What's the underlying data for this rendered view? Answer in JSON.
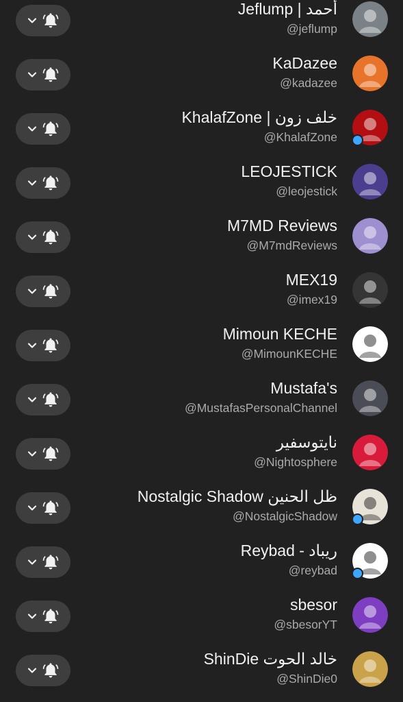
{
  "subscriptions": [
    {
      "name": "Jeflump | أحمد",
      "handle": "@jeflump",
      "avatar_color": "#7a8288",
      "live_dot": false,
      "avatar_icon": "jeflump-avatar"
    },
    {
      "name": "KaDazee",
      "handle": "@kadazee",
      "avatar_color": "#e7742a",
      "live_dot": false,
      "avatar_icon": "kadazee-avatar"
    },
    {
      "name": "KhalafZone | خلف زون",
      "handle": "@KhalafZone",
      "avatar_color": "#b30f12",
      "live_dot": true,
      "avatar_icon": "khalafzone-avatar"
    },
    {
      "name": "LEOJESTICK",
      "handle": "@leojestick",
      "avatar_color": "#4c3e8f",
      "live_dot": false,
      "avatar_icon": "leojestick-avatar"
    },
    {
      "name": "M7MD Reviews",
      "handle": "@M7mdReviews",
      "avatar_color": "#9e8fd1",
      "live_dot": false,
      "avatar_icon": "m7md-avatar"
    },
    {
      "name": "MEX19",
      "handle": "@imex19",
      "avatar_color": "#353535",
      "live_dot": false,
      "avatar_icon": "mex19-avatar"
    },
    {
      "name": "Mimoun KECHE",
      "handle": "@MimounKECHE",
      "avatar_color": "#ffffff",
      "live_dot": false,
      "avatar_icon": "mimoun-avatar"
    },
    {
      "name": "Mustafa's",
      "handle": "@MustafasPersonalChannel",
      "avatar_color": "#4a4d55",
      "live_dot": false,
      "avatar_icon": "mustafa-avatar"
    },
    {
      "name": "نايتوسفير",
      "handle": "@Nightosphere",
      "avatar_color": "#d81b3a",
      "live_dot": false,
      "avatar_icon": "nightosphere-avatar"
    },
    {
      "name": "Nostalgic Shadow ظل الحنين",
      "handle": "@NostalgicShadow",
      "avatar_color": "#e8e3d8",
      "live_dot": true,
      "avatar_icon": "nostalgic-avatar"
    },
    {
      "name": "Reybad - ريباد",
      "handle": "@reybad",
      "avatar_color": "#ffffff",
      "live_dot": true,
      "avatar_icon": "reybad-avatar"
    },
    {
      "name": "sbesor",
      "handle": "@sbesorYT",
      "avatar_color": "#7e3ec2",
      "live_dot": false,
      "avatar_icon": "sbesor-avatar"
    },
    {
      "name": "ShinDie خالد الحوت",
      "handle": "@ShinDie0",
      "avatar_color": "#c9a24a",
      "live_dot": false,
      "avatar_icon": "shindie-avatar"
    }
  ],
  "colors": {
    "background": "#212121",
    "button": "#3e3e3e",
    "primary_text": "#f1f1f1",
    "secondary_text": "#aaaaaa",
    "live_dot": "#3ea6ff"
  }
}
